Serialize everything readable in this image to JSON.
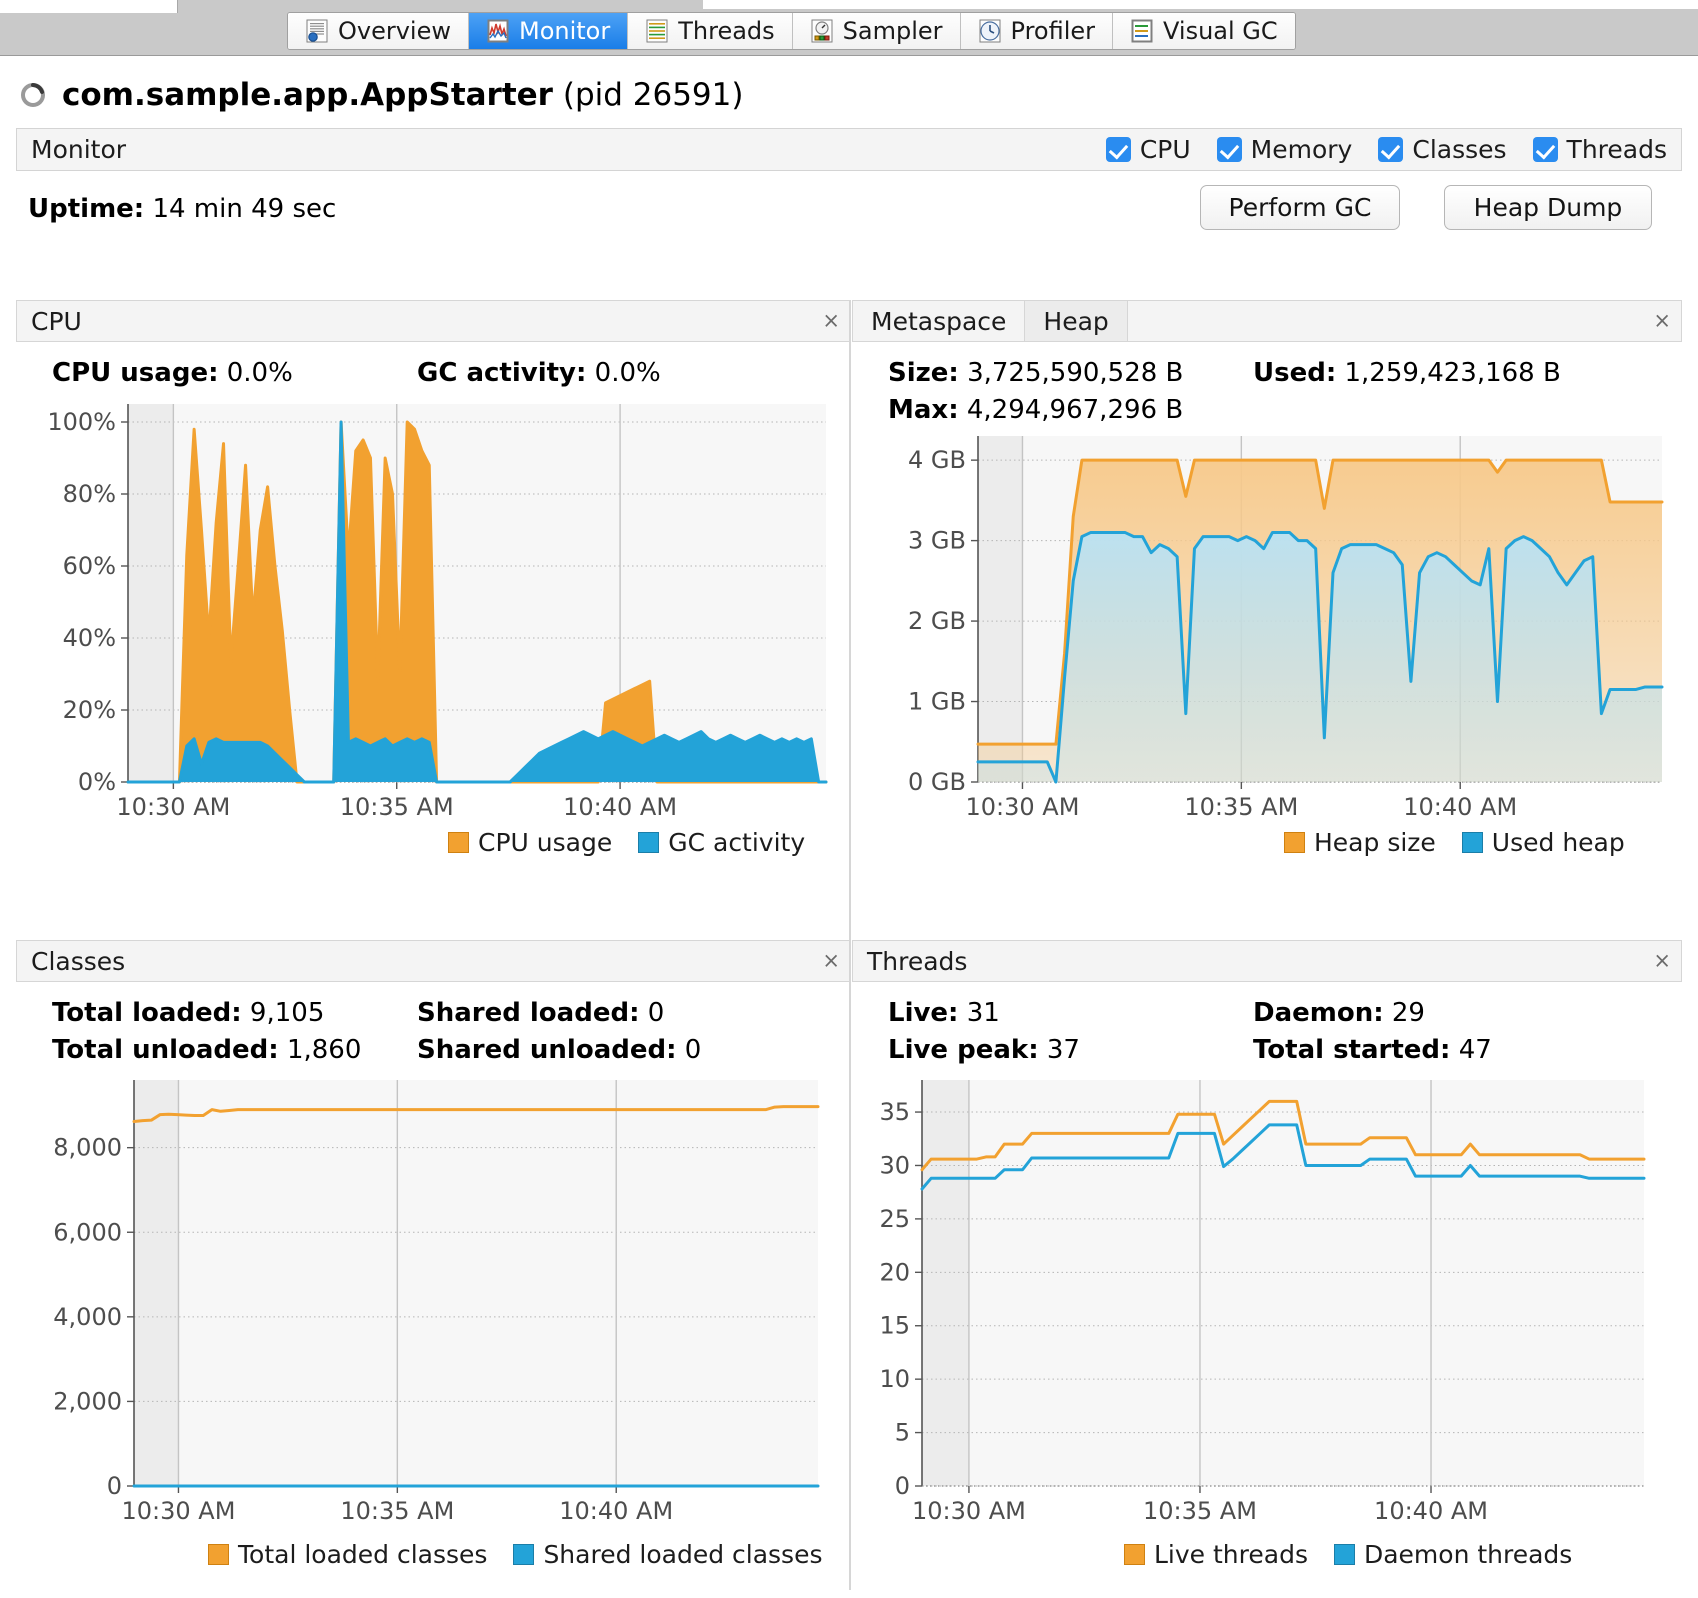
{
  "window": {
    "tabs": [
      {
        "label": "Overview",
        "icon": "overview-icon",
        "active": false
      },
      {
        "label": "Monitor",
        "icon": "monitor-icon",
        "active": true
      },
      {
        "label": "Threads",
        "icon": "threads-icon",
        "active": false
      },
      {
        "label": "Sampler",
        "icon": "sampler-icon",
        "active": false
      },
      {
        "label": "Profiler",
        "icon": "profiler-icon",
        "active": false
      },
      {
        "label": "Visual GC",
        "icon": "visualgc-icon",
        "active": false
      }
    ]
  },
  "header": {
    "app_name": "com.sample.app.AppStarter",
    "pid_text": "(pid 26591)",
    "status_icon": "loading-spinner-icon"
  },
  "monitor_bar": {
    "label": "Monitor",
    "checkboxes": [
      {
        "label": "CPU",
        "checked": true
      },
      {
        "label": "Memory",
        "checked": true
      },
      {
        "label": "Classes",
        "checked": true
      },
      {
        "label": "Threads",
        "checked": true
      }
    ]
  },
  "toolbar": {
    "uptime_label": "Uptime:",
    "uptime_value": "14 min 49 sec",
    "perform_gc_label": "Perform GC",
    "heap_dump_label": "Heap Dump"
  },
  "cpu_panel": {
    "title": "CPU",
    "close_glyph": "×",
    "stats": [
      {
        "label": "CPU usage:",
        "value": "0.0%"
      },
      {
        "label": "GC activity:",
        "value": "0.0%"
      }
    ],
    "legend": [
      {
        "label": "CPU usage",
        "color": "#f2a130"
      },
      {
        "label": "GC activity",
        "color": "#23a3d8"
      }
    ]
  },
  "heap_panel": {
    "tabs": [
      {
        "label": "Heap",
        "selected": true
      },
      {
        "label": "Metaspace",
        "selected": false
      }
    ],
    "close_glyph": "×",
    "stats": [
      {
        "label": "Size:",
        "value": "3,725,590,528 B"
      },
      {
        "label": "Used:",
        "value": "1,259,423,168 B"
      },
      {
        "label": "Max:",
        "value": "4,294,967,296 B"
      }
    ],
    "legend": [
      {
        "label": "Heap size",
        "color": "#f2a130"
      },
      {
        "label": "Used heap",
        "color": "#23a3d8"
      }
    ]
  },
  "classes_panel": {
    "title": "Classes",
    "close_glyph": "×",
    "stats": [
      {
        "label": "Total loaded:",
        "value": "9,105"
      },
      {
        "label": "Shared loaded:",
        "value": "0"
      },
      {
        "label": "Total unloaded:",
        "value": "1,860"
      },
      {
        "label": "Shared unloaded:",
        "value": "0"
      }
    ],
    "legend": [
      {
        "label": "Total loaded classes",
        "color": "#f2a130"
      },
      {
        "label": "Shared loaded classes",
        "color": "#23a3d8"
      }
    ]
  },
  "threads_panel": {
    "title": "Threads",
    "close_glyph": "×",
    "stats": [
      {
        "label": "Live:",
        "value": "31"
      },
      {
        "label": "Daemon:",
        "value": "29"
      },
      {
        "label": "Live peak:",
        "value": "37"
      },
      {
        "label": "Total started:",
        "value": "47"
      }
    ],
    "legend": [
      {
        "label": "Live threads",
        "color": "#f2a130"
      },
      {
        "label": "Daemon threads",
        "color": "#23a3d8"
      }
    ]
  },
  "chart_data": [
    {
      "id": "cpu",
      "type": "area",
      "title": "CPU",
      "xlabel": "",
      "ylabel": "",
      "ylim": [
        0,
        105
      ],
      "yticks": [
        0,
        20,
        40,
        60,
        80,
        100
      ],
      "yticklabels": [
        "0%",
        "20%",
        "40%",
        "60%",
        "80%",
        "100%"
      ],
      "xticklabels": [
        "10:30 AM",
        "10:35 AM",
        "10:40 AM"
      ],
      "grid": true,
      "legend_position": "bottom",
      "series": [
        {
          "name": "CPU usage",
          "color": "#f2a130",
          "values": [
            0,
            0,
            0,
            0,
            0,
            0,
            0,
            0,
            63,
            98,
            70,
            40,
            72,
            94,
            33,
            60,
            88,
            45,
            70,
            82,
            60,
            42,
            20,
            0,
            0,
            0,
            0,
            0,
            0,
            100,
            63,
            92,
            95,
            90,
            28,
            90,
            80,
            30,
            100,
            98,
            92,
            88,
            0,
            0,
            0,
            0,
            0,
            0,
            0,
            0,
            0,
            0,
            0,
            0,
            0,
            0,
            0,
            0,
            0,
            0,
            0,
            0,
            0,
            0,
            0,
            22,
            23,
            24,
            25,
            26,
            27,
            28,
            0,
            0,
            0,
            0,
            0,
            0,
            0,
            0,
            0,
            0,
            0,
            0,
            0,
            0,
            0,
            0,
            0,
            0,
            0,
            0,
            0,
            0,
            0,
            0
          ]
        },
        {
          "name": "GC activity",
          "color": "#23a3d8",
          "values": [
            0,
            0,
            0,
            0,
            0,
            0,
            0,
            0,
            10,
            12,
            5,
            11,
            12,
            11,
            11,
            11,
            11,
            11,
            11,
            10,
            8,
            6,
            4,
            2,
            0,
            0,
            0,
            0,
            0,
            100,
            11,
            12,
            11,
            10,
            11,
            12,
            10,
            11,
            12,
            11,
            12,
            11,
            0,
            0,
            0,
            0,
            0,
            0,
            0,
            0,
            0,
            0,
            0,
            2,
            4,
            6,
            8,
            9,
            10,
            11,
            12,
            13,
            14,
            13,
            12,
            13,
            14,
            13,
            12,
            11,
            10,
            11,
            12,
            13,
            12,
            11,
            12,
            13,
            14,
            12,
            11,
            12,
            13,
            12,
            11,
            12,
            13,
            12,
            11,
            12,
            11,
            12,
            11,
            12,
            0,
            0
          ]
        }
      ]
    },
    {
      "id": "heap",
      "type": "area",
      "title": "Heap",
      "xlabel": "",
      "ylabel": "",
      "ylim": [
        0,
        4.3
      ],
      "yticks": [
        0,
        1,
        2,
        3,
        4
      ],
      "yticklabels": [
        "0 GB",
        "1 GB",
        "2 GB",
        "3 GB",
        "4 GB"
      ],
      "xticklabels": [
        "10:30 AM",
        "10:35 AM",
        "10:40 AM"
      ],
      "grid": true,
      "legend_position": "bottom",
      "series": [
        {
          "name": "Heap size",
          "color": "#f2a130",
          "fill": "#f7c98a",
          "values": [
            0.47,
            0.47,
            0.47,
            0.47,
            0.47,
            0.47,
            0.47,
            0.47,
            0.47,
            0.47,
            1.6,
            3.3,
            4.0,
            4.0,
            4.0,
            4.0,
            4.0,
            4.0,
            4.0,
            4.0,
            4.0,
            4.0,
            4.0,
            4.0,
            3.55,
            4.0,
            4.0,
            4.0,
            4.0,
            4.0,
            4.0,
            4.0,
            4.0,
            4.0,
            4.0,
            4.0,
            4.0,
            4.0,
            4.0,
            4.0,
            3.4,
            4.0,
            4.0,
            4.0,
            4.0,
            4.0,
            4.0,
            4.0,
            4.0,
            4.0,
            4.0,
            4.0,
            4.0,
            4.0,
            4.0,
            4.0,
            4.0,
            4.0,
            4.0,
            4.0,
            3.85,
            4.0,
            4.0,
            4.0,
            4.0,
            4.0,
            4.0,
            4.0,
            4.0,
            4.0,
            4.0,
            4.0,
            4.0,
            3.48,
            3.48,
            3.48,
            3.48,
            3.48,
            3.48,
            3.48
          ]
        },
        {
          "name": "Used heap",
          "color": "#23a3d8",
          "fill": "#b9e2f4",
          "values": [
            0.25,
            0.25,
            0.25,
            0.25,
            0.25,
            0.25,
            0.25,
            0.25,
            0.25,
            0.0,
            1.3,
            2.5,
            3.05,
            3.1,
            3.1,
            3.1,
            3.1,
            3.1,
            3.05,
            3.05,
            2.85,
            2.95,
            2.9,
            2.8,
            0.85,
            2.9,
            3.05,
            3.05,
            3.05,
            3.05,
            3.0,
            3.05,
            3.0,
            2.9,
            3.1,
            3.1,
            3.1,
            3.0,
            3.0,
            2.9,
            0.55,
            2.6,
            2.9,
            2.95,
            2.95,
            2.95,
            2.95,
            2.9,
            2.85,
            2.7,
            1.25,
            2.6,
            2.8,
            2.85,
            2.8,
            2.7,
            2.6,
            2.5,
            2.45,
            2.9,
            1.0,
            2.9,
            3.0,
            3.05,
            3.0,
            2.9,
            2.8,
            2.6,
            2.45,
            2.6,
            2.75,
            2.8,
            0.85,
            1.15,
            1.15,
            1.15,
            1.15,
            1.18,
            1.18,
            1.18
          ]
        }
      ]
    },
    {
      "id": "classes",
      "type": "line",
      "title": "Classes",
      "xlabel": "",
      "ylabel": "",
      "ylim": [
        0,
        9600
      ],
      "yticks": [
        0,
        2000,
        4000,
        6000,
        8000
      ],
      "yticklabels": [
        "0",
        "2,000",
        "4,000",
        "6,000",
        "8,000"
      ],
      "xticklabels": [
        "10:30 AM",
        "10:35 AM",
        "10:40 AM"
      ],
      "grid": true,
      "legend_position": "bottom",
      "series": [
        {
          "name": "Total loaded classes",
          "color": "#f2a130",
          "values": [
            8620,
            8640,
            8650,
            8780,
            8790,
            8780,
            8770,
            8760,
            8760,
            8900,
            8860,
            8880,
            8900,
            8900,
            8900,
            8900,
            8900,
            8900,
            8900,
            8900,
            8900,
            8900,
            8900,
            8900,
            8900,
            8900,
            8900,
            8900,
            8900,
            8900,
            8900,
            8900,
            8900,
            8900,
            8900,
            8900,
            8900,
            8900,
            8900,
            8900,
            8900,
            8900,
            8900,
            8900,
            8900,
            8900,
            8900,
            8900,
            8900,
            8900,
            8900,
            8900,
            8900,
            8900,
            8900,
            8900,
            8900,
            8900,
            8900,
            8900,
            8900,
            8900,
            8900,
            8900,
            8900,
            8900,
            8900,
            8900,
            8900,
            8900,
            8900,
            8900,
            8900,
            8900,
            8960,
            8970,
            8970,
            8970,
            8970,
            8970
          ]
        },
        {
          "name": "Shared loaded classes",
          "color": "#23a3d8",
          "values": [
            0,
            0,
            0,
            0,
            0,
            0,
            0,
            0,
            0,
            0,
            0,
            0,
            0,
            0,
            0,
            0,
            0,
            0,
            0,
            0,
            0,
            0,
            0,
            0,
            0,
            0,
            0,
            0,
            0,
            0,
            0,
            0,
            0,
            0,
            0,
            0,
            0,
            0,
            0,
            0,
            0,
            0,
            0,
            0,
            0,
            0,
            0,
            0,
            0,
            0,
            0,
            0,
            0,
            0,
            0,
            0,
            0,
            0,
            0,
            0,
            0,
            0,
            0,
            0,
            0,
            0,
            0,
            0,
            0,
            0,
            0,
            0,
            0,
            0,
            0,
            0,
            0,
            0,
            0,
            0
          ]
        }
      ]
    },
    {
      "id": "threads",
      "type": "line",
      "title": "Threads",
      "xlabel": "",
      "ylabel": "",
      "ylim": [
        0,
        38
      ],
      "yticks": [
        0,
        5,
        10,
        15,
        20,
        25,
        30,
        35
      ],
      "yticklabels": [
        "0",
        "5",
        "10",
        "15",
        "20",
        "25",
        "30",
        "35"
      ],
      "xticklabels": [
        "10:30 AM",
        "10:35 AM",
        "10:40 AM"
      ],
      "grid": true,
      "legend_position": "bottom",
      "series": [
        {
          "name": "Live threads",
          "color": "#f2a130",
          "values": [
            29.6,
            30.6,
            30.6,
            30.6,
            30.6,
            30.6,
            30.6,
            30.8,
            30.8,
            32,
            32,
            32,
            33,
            33,
            33,
            33,
            33,
            33,
            33,
            33,
            33,
            33,
            33,
            33,
            33,
            33,
            33,
            33,
            34.8,
            34.8,
            34.8,
            34.8,
            34.8,
            32,
            32.8,
            33.6,
            34.4,
            35.2,
            36,
            36,
            36,
            36,
            32,
            32,
            32,
            32,
            32,
            32,
            32,
            32.6,
            32.6,
            32.6,
            32.6,
            32.6,
            31,
            31,
            31,
            31,
            31,
            31,
            32,
            31,
            31,
            31,
            31,
            31,
            31,
            31,
            31,
            31,
            31,
            31,
            31,
            30.6,
            30.6,
            30.6,
            30.6,
            30.6,
            30.6,
            30.6
          ]
        },
        {
          "name": "Daemon threads",
          "color": "#23a3d8",
          "values": [
            27.8,
            28.8,
            28.8,
            28.8,
            28.8,
            28.8,
            28.8,
            28.8,
            28.8,
            29.6,
            29.6,
            29.6,
            30.7,
            30.7,
            30.7,
            30.7,
            30.7,
            30.7,
            30.7,
            30.7,
            30.7,
            30.7,
            30.7,
            30.7,
            30.7,
            30.7,
            30.7,
            30.7,
            33,
            33,
            33,
            33,
            33,
            29.9,
            30.6,
            31.4,
            32.2,
            33,
            33.8,
            33.8,
            33.8,
            33.8,
            30,
            30,
            30,
            30,
            30,
            30,
            30,
            30.6,
            30.6,
            30.6,
            30.6,
            30.6,
            29,
            29,
            29,
            29,
            29,
            29,
            30,
            29,
            29,
            29,
            29,
            29,
            29,
            29,
            29,
            29,
            29,
            29,
            29,
            28.8,
            28.8,
            28.8,
            28.8,
            28.8,
            28.8,
            28.8
          ]
        }
      ]
    }
  ]
}
